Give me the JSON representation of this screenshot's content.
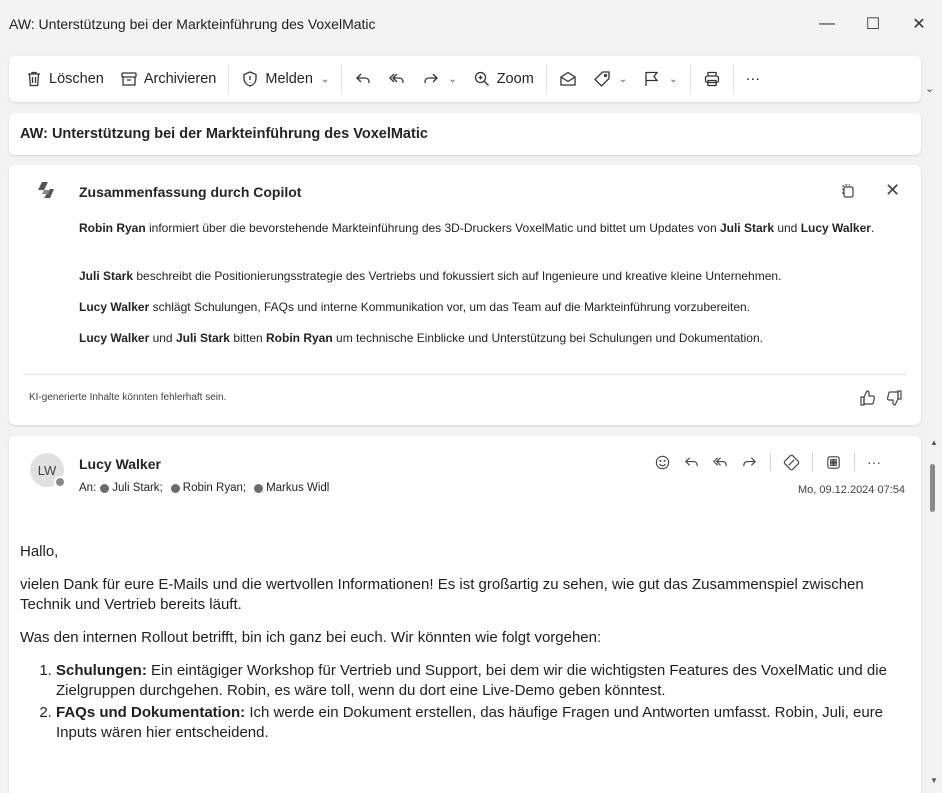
{
  "window": {
    "title": "AW: Unterstützung bei der Markteinführung des VoxelMatic",
    "minimize": "—",
    "maximize": "☐",
    "close": "✕"
  },
  "toolbar": {
    "delete_label": "Löschen",
    "archive_label": "Archivieren",
    "report_label": "Melden",
    "zoom_label": "Zoom",
    "more_label": "···",
    "overflow_label": "⌄"
  },
  "subject": "AW: Unterstützung bei der Markteinführung des VoxelMatic",
  "copilot": {
    "title": "Zusammenfassung durch Copilot",
    "close": "✕",
    "paragraphs": [
      [
        {
          "t": "Robin Ryan",
          "b": true
        },
        {
          "t": " informiert über die bevorstehende Markteinführung des 3D-Druckers VoxelMatic und bittet um Updates von ",
          "b": false
        },
        {
          "t": "Juli Stark",
          "b": true
        },
        {
          "t": " und ",
          "b": false
        },
        {
          "t": "Lucy Walker",
          "b": true
        },
        {
          "t": ".",
          "b": false
        }
      ],
      [
        {
          "t": "Juli Stark",
          "b": true
        },
        {
          "t": " beschreibt die Positionierungsstrategie des Vertriebs und fokussiert sich auf Ingenieure und kreative kleine Unternehmen.",
          "b": false
        }
      ],
      [
        {
          "t": "Lucy Walker",
          "b": true
        },
        {
          "t": " schlägt Schulungen, FAQs und interne Kommunikation vor, um das Team auf die Markteinführung vorzubereiten.",
          "b": false
        }
      ],
      [
        {
          "t": "Lucy Walker",
          "b": true
        },
        {
          "t": " und ",
          "b": false
        },
        {
          "t": "Juli Stark",
          "b": true
        },
        {
          "t": " bitten ",
          "b": false
        },
        {
          "t": "Robin Ryan",
          "b": true
        },
        {
          "t": " um technische Einblicke und Unterstützung bei Schulungen und Dokumentation.",
          "b": false
        }
      ]
    ],
    "disclaimer": "KI-generierte Inhalte könnten fehlerhaft sein."
  },
  "message": {
    "avatar_initials": "LW",
    "sender": "Lucy Walker",
    "to_label": "An:",
    "recipients": [
      "Juli Stark;",
      "Robin Ryan;",
      "Markus Widl"
    ],
    "date": "Mo, 09.12.2024 07:54",
    "more_label": "···",
    "greeting": "Hallo,",
    "para1": "vielen Dank für eure E-Mails und die wertvollen Informationen! Es ist großartig zu sehen, wie gut das Zusammenspiel zwischen Technik und Vertrieb bereits läuft.",
    "para2": "Was den internen Rollout betrifft, bin ich ganz bei euch. Wir könnten wie folgt vorgehen:",
    "list": [
      {
        "head": "Schulungen:",
        "text": " Ein eintägiger Workshop für Vertrieb und Support, bei dem wir die wichtigsten Features des VoxelMatic und die Zielgruppen durchgehen. Robin, es wäre toll, wenn du dort eine Live-Demo geben könntest."
      },
      {
        "head": "FAQs und Dokumentation:",
        "text": " Ich werde ein Dokument erstellen, das häufige Fragen und Antworten umfasst. Robin, Juli, eure Inputs wären hier entscheidend."
      }
    ]
  },
  "scrollbar": {
    "up": "▲",
    "down": "▼"
  },
  "colors": {
    "accent": "#0f6cbd",
    "background": "#f3f3f3",
    "card": "#ffffff"
  }
}
